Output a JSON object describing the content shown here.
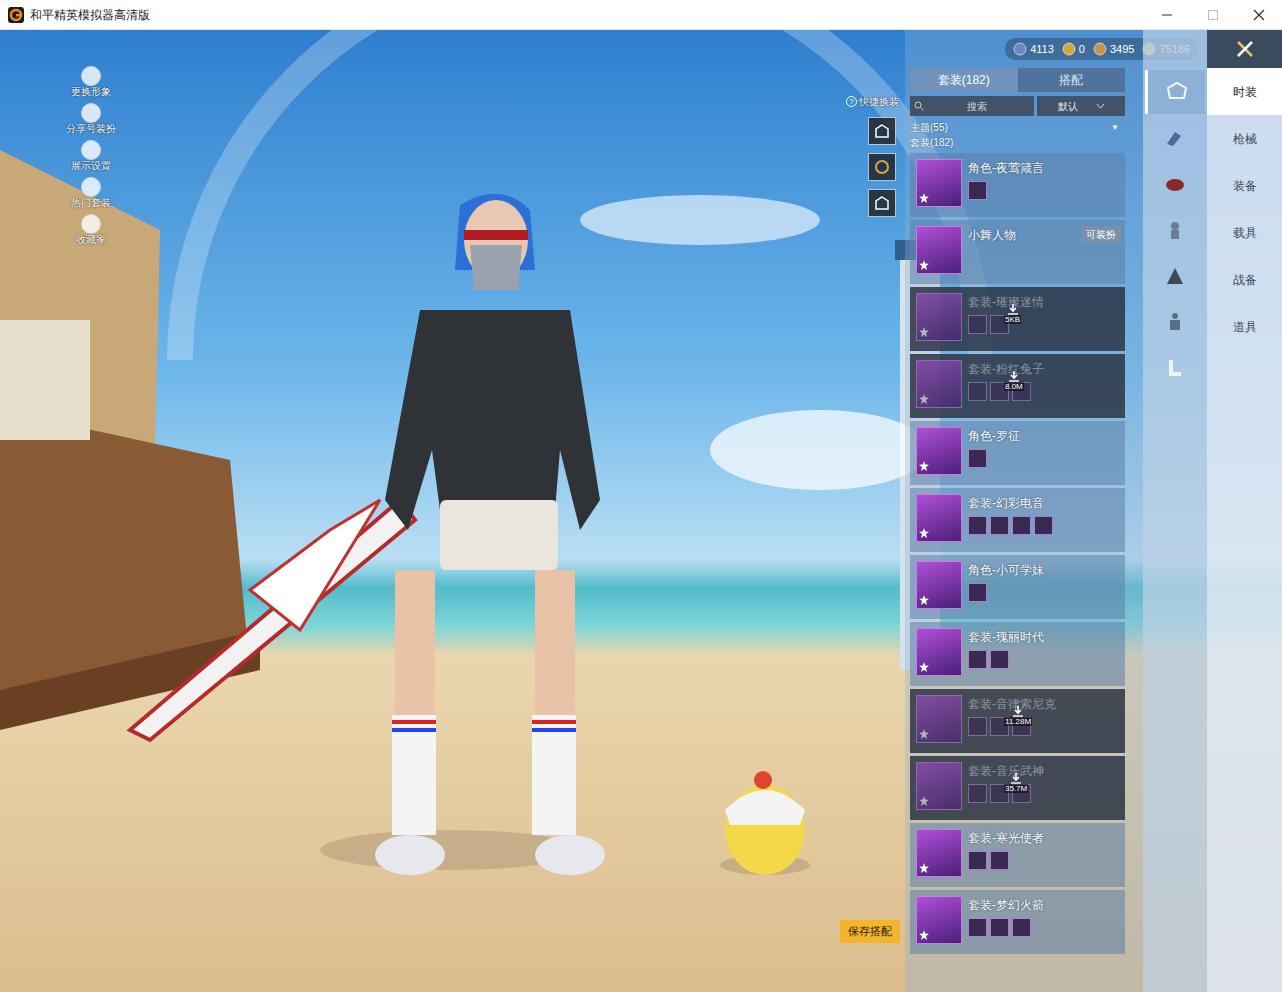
{
  "window": {
    "title": "和平精英模拟器高清版"
  },
  "left_menu": [
    {
      "label": "更换形象"
    },
    {
      "label": "分享号装扮"
    },
    {
      "label": "展示设置"
    },
    {
      "label": "热门套装"
    },
    {
      "label": "收藏家"
    }
  ],
  "currencies": [
    {
      "amount": "4113"
    },
    {
      "amount": "0"
    },
    {
      "amount": "3495"
    },
    {
      "amount": "75186"
    }
  ],
  "quick_change": {
    "label": "快捷换装",
    "help": "?"
  },
  "panel": {
    "tabs": [
      {
        "label": "套装(182)",
        "selected": true
      },
      {
        "label": "搭配",
        "selected": false
      }
    ],
    "search": {
      "placeholder": "搜索"
    },
    "sort": {
      "label": "默认"
    },
    "group": {
      "label": "主题(55)",
      "arrow": "▼"
    },
    "section": "套装(182)",
    "items": [
      {
        "name": "角色-夜莺箴言",
        "downloaded": true,
        "parts": 1,
        "size": "",
        "badge": ""
      },
      {
        "name": "小舞人物",
        "downloaded": true,
        "parts": 0,
        "size": "",
        "badge": "可装扮"
      },
      {
        "name": "套装-璀璨迷情",
        "downloaded": false,
        "parts": 2,
        "size": "5KB",
        "badge": ""
      },
      {
        "name": "套装-粉红兔子",
        "downloaded": false,
        "parts": 3,
        "size": "8.0M",
        "badge": ""
      },
      {
        "name": "角色-罗征",
        "downloaded": true,
        "parts": 1,
        "size": "",
        "badge": ""
      },
      {
        "name": "套装-幻彩电音",
        "downloaded": true,
        "parts": 4,
        "size": "",
        "badge": ""
      },
      {
        "name": "角色-小可学妹",
        "downloaded": true,
        "parts": 1,
        "size": "",
        "badge": ""
      },
      {
        "name": "套装-瑰丽时代",
        "downloaded": true,
        "parts": 2,
        "size": "",
        "badge": ""
      },
      {
        "name": "套装-音律索尼克",
        "downloaded": false,
        "parts": 3,
        "size": "11.28M",
        "badge": ""
      },
      {
        "name": "套装-音乐武神",
        "downloaded": false,
        "parts": 3,
        "size": "35.7M",
        "badge": ""
      },
      {
        "name": "套装-寒光使者",
        "downloaded": true,
        "parts": 2,
        "size": "",
        "badge": ""
      },
      {
        "name": "套装-梦幻火箭",
        "downloaded": true,
        "parts": 3,
        "size": "",
        "badge": ""
      }
    ]
  },
  "categories": [
    {
      "selected": true
    },
    {
      "selected": false
    },
    {
      "selected": false
    },
    {
      "selected": false
    },
    {
      "selected": false
    },
    {
      "selected": false
    },
    {
      "selected": false
    }
  ],
  "nav": [
    {
      "label": "时装",
      "selected": true
    },
    {
      "label": "枪械",
      "selected": false
    },
    {
      "label": "装备",
      "selected": false
    },
    {
      "label": "载具",
      "selected": false
    },
    {
      "label": "战备",
      "selected": false
    },
    {
      "label": "道具",
      "selected": false
    }
  ],
  "save_button": "保存搭配"
}
